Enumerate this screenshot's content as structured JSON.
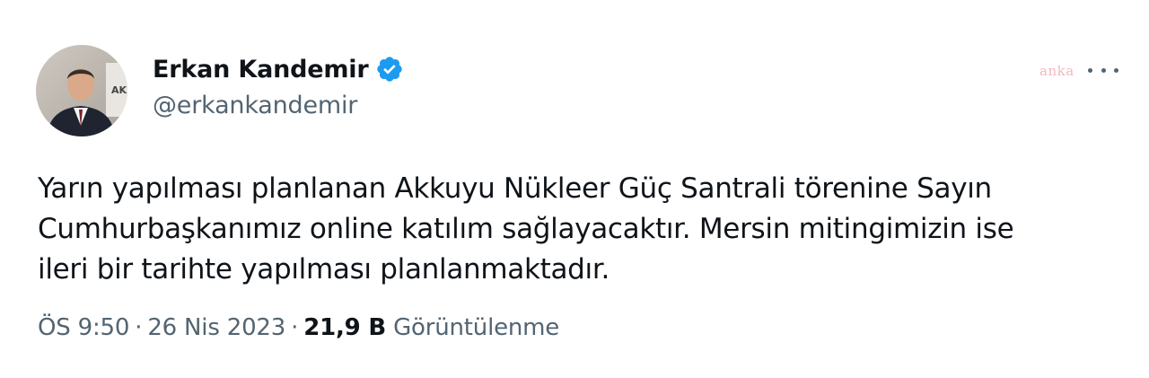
{
  "author": {
    "display_name": "Erkan Kandemir",
    "handle": "@erkankandemir",
    "verified": true,
    "verified_color": "#1d9bf0"
  },
  "watermark": "anka",
  "tweet": {
    "lines": [
      "Yarın yapılması planlanan Akkuyu Nükleer Güç Santrali törenine Sayın",
      "Cumhurbaşkanımız online katılım sağlayacaktır. Mersin mitingimizin ise",
      "ileri bir tarihte yapılması planlanmaktadır."
    ]
  },
  "meta": {
    "time": "ÖS 9:50",
    "separator": "·",
    "date": "26 Nis 2023",
    "views_count": "21,9 B",
    "views_label": "Görüntülenme"
  }
}
